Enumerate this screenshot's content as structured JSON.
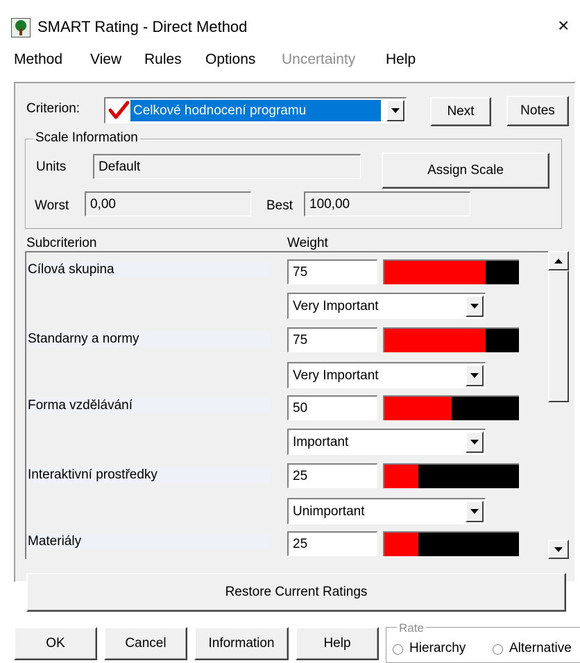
{
  "window": {
    "title": "SMART Rating - Direct Method",
    "close_glyph": "×"
  },
  "menu": [
    "Method",
    "View",
    "Rules",
    "Options",
    "Uncertainty",
    "Help"
  ],
  "criterion": {
    "label": "Criterion:",
    "selected": "Celkové hodnocení programu",
    "next_label": "Next",
    "notes_label": "Notes"
  },
  "scale": {
    "group_title": "Scale Information",
    "units_label": "Units",
    "units_value": "Default",
    "assign_label": "Assign Scale",
    "worst_label": "Worst",
    "worst_value": "0,00",
    "best_label": "Best",
    "best_value": "100,00"
  },
  "table": {
    "subcriterion_header": "Subcriterion",
    "weight_header": "Weight",
    "rows": [
      {
        "name": "Cílová skupina",
        "weight": "75",
        "importance": "Very Important",
        "fill": 0.75
      },
      {
        "name": "Standarny a normy",
        "weight": "75",
        "importance": "Very Important",
        "fill": 0.75
      },
      {
        "name": "Forma vzdělávání",
        "weight": "50",
        "importance": "Important",
        "fill": 0.5
      },
      {
        "name": "Interaktivní prostředky",
        "weight": "25",
        "importance": "Unimportant",
        "fill": 0.25
      },
      {
        "name": "Materiály",
        "weight": "25",
        "importance": "",
        "fill": 0.25
      }
    ]
  },
  "restore_label": "Restore Current Ratings",
  "buttons": {
    "ok": "OK",
    "cancel": "Cancel",
    "information": "Information",
    "help": "Help"
  },
  "rate": {
    "title": "Rate",
    "hierarchy": "Hierarchy",
    "alternative": "Alternative"
  },
  "colors": {
    "bar_fill": "#ff0000",
    "bar_empty": "#000000",
    "selection": "#0078d7",
    "check": "#e00000"
  },
  "icons": {
    "app": "tree-icon",
    "check": "checkmark-icon"
  }
}
